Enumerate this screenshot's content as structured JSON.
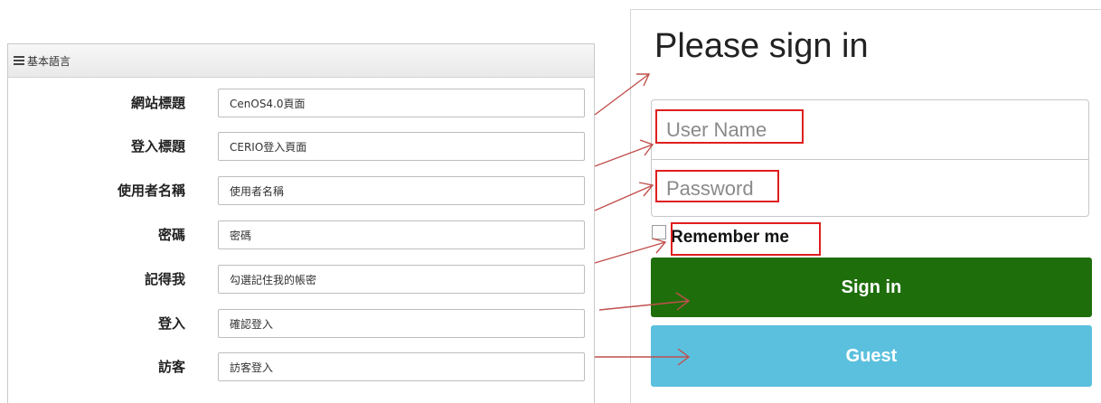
{
  "left_panel": {
    "header_title": "基本語言",
    "rows": [
      {
        "label": "網站標題",
        "value": "CenOS4.0頁面"
      },
      {
        "label": "登入標題",
        "value": "CERIO登入頁面"
      },
      {
        "label": "使用者名稱",
        "value": "使用者名稱"
      },
      {
        "label": "密碼",
        "value": "密碼"
      },
      {
        "label": "記得我",
        "value": "勾選記住我的帳密"
      },
      {
        "label": "登入",
        "value": "確認登入"
      },
      {
        "label": "訪客",
        "value": "訪客登入"
      }
    ]
  },
  "signin_panel": {
    "title": "Please sign in",
    "username_placeholder": "User Name",
    "password_placeholder": "Password",
    "remember_label": "Remember me",
    "signin_label": "Sign in",
    "guest_label": "Guest"
  },
  "colors": {
    "signin_button": "#1f6e0c",
    "guest_button": "#5bc0de",
    "highlight": "#e01e1e",
    "arrow": "#c0504d"
  }
}
